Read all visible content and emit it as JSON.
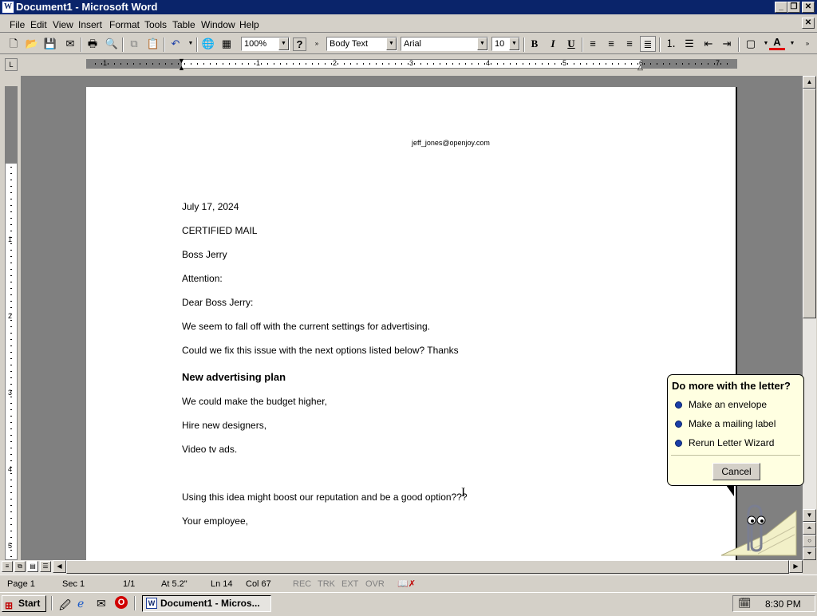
{
  "window": {
    "title": "Document1 - Microsoft Word",
    "app_icon": "W"
  },
  "menu": [
    {
      "label": "File"
    },
    {
      "label": "Edit"
    },
    {
      "label": "View"
    },
    {
      "label": "Insert"
    },
    {
      "label": "Format"
    },
    {
      "label": "Tools"
    },
    {
      "label": "Table"
    },
    {
      "label": "Window"
    },
    {
      "label": "Help"
    }
  ],
  "toolbar": {
    "zoom": "100%",
    "style": "Body Text",
    "font": "Arial",
    "size": "10",
    "bold": "B",
    "italic": "I",
    "underline": "U",
    "font_color_glyph": "A",
    "help_glyph": "?"
  },
  "ruler": {
    "numbers": [
      "1",
      "1",
      "2",
      "3",
      "4",
      "5",
      "6",
      "7"
    ],
    "tab_glyph": "L"
  },
  "vruler": {
    "numbers": [
      "1",
      "2",
      "3",
      "4",
      "5"
    ]
  },
  "document": {
    "header_email": "jeff_jones@openjoy.com",
    "lines": [
      "July 17, 2024",
      "CERTIFIED MAIL",
      "Boss Jerry",
      "Attention:",
      "Dear Boss Jerry:",
      "We seem to fall off with the current settings for advertising.",
      "Could we fix this issue with the next options listed below? Thanks",
      "New advertising plan",
      "We could make the budget higher,",
      "Hire new designers,",
      "Video tv ads.",
      "Using this idea might boost our reputation and be a good option???",
      "Your employee,"
    ]
  },
  "assistant": {
    "heading": "Do more with the letter?",
    "options": [
      "Make an envelope",
      "Make a mailing label",
      "Rerun Letter Wizard"
    ],
    "cancel": "Cancel"
  },
  "status": {
    "page": "Page  1",
    "sec": "Sec  1",
    "pages": "1/1",
    "at": "At  5.2\"",
    "ln": "Ln  14",
    "col": "Col  67",
    "rec": "REC",
    "trk": "TRK",
    "ext": "EXT",
    "ovr": "OVR"
  },
  "taskbar": {
    "start": "Start",
    "task": "Document1 - Micros...",
    "clock": "8:30 PM"
  }
}
